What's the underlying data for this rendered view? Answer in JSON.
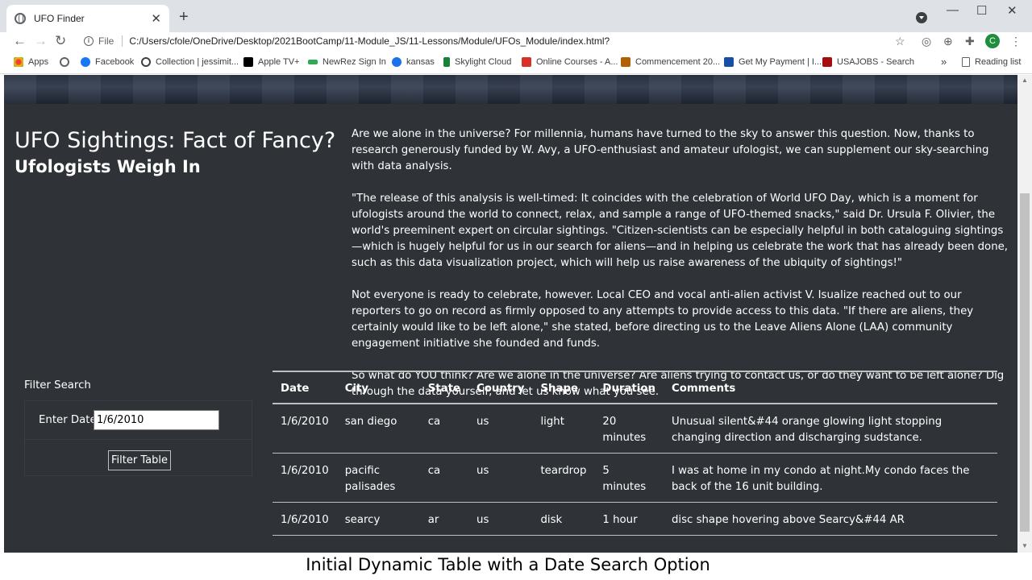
{
  "browser": {
    "tab_title": "UFO Finder",
    "tab_close": "✕",
    "new_tab": "+",
    "window_controls": [
      "—",
      "☐",
      "✕"
    ],
    "file_label": "File",
    "url": "C:/Users/cfole/OneDrive/Desktop/2021BootCamp/11-Module_JS/11-Lessons/Module/UFOs_Module/index.html?",
    "avatar_letter": "C"
  },
  "bookmarks": [
    {
      "label": "Apps",
      "icon": "apps-grid-icon",
      "color": "#ea4335"
    },
    {
      "label": "",
      "icon": "globe-icon",
      "color": "#5f6368"
    },
    {
      "label": "Facebook",
      "icon": "facebook-icon",
      "color": "#1877f2"
    },
    {
      "label": "Collection | jessimit...",
      "icon": "gear-icon",
      "color": "#3c4043"
    },
    {
      "label": "Apple TV+",
      "icon": "appletv-icon",
      "color": "#000000"
    },
    {
      "label": "NewRez Sign In",
      "icon": "newrez-icon",
      "color": "#34a853"
    },
    {
      "label": "kansas",
      "icon": "kansas-icon",
      "color": "#1a73e8"
    },
    {
      "label": "Skylight Cloud",
      "icon": "skylight-icon",
      "color": "#188038"
    },
    {
      "label": "Online Courses - A...",
      "icon": "courses-icon",
      "color": "#d93025"
    },
    {
      "label": "Commencement 20...",
      "icon": "commencement-icon",
      "color": "#b06000"
    },
    {
      "label": "Get My Payment | I...",
      "icon": "irs-icon",
      "color": "#174ea6"
    },
    {
      "label": "USAJOBS - Search",
      "icon": "usajobs-icon",
      "color": "#a50e0e"
    }
  ],
  "bookmarks_more": "»",
  "reading_list": "Reading list",
  "page": {
    "title": "UFO Sightings: Fact of Fancy?",
    "subtitle": "Ufologists Weigh In",
    "paragraphs": [
      "Are we alone in the universe? For millennia, humans have turned to the sky to answer this question. Now, thanks to research generously funded by W. Avy, a UFO-enthusiast and amateur ufologist, we can supplement our sky-searching with data analysis.",
      "\"The release of this analysis is well-timed: It coincides with the celebration of World UFO Day, which is a moment for ufologists around the world to connect, relax, and sample a range of UFO-themed snacks,\" said Dr. Ursula F. Olivier, the world's preeminent expert on circular sightings. \"Citizen-scientists can be especially helpful in both cataloguing sightings—which is hugely helpful for us in our search for aliens—and in helping us celebrate the work that has already been done, such as this data visualization project, which will help us raise awareness of the ubiquity of sightings!\"",
      "Not everyone is ready to celebrate, however. Local CEO and vocal anti-alien activist V. Isualize reached out to our reporters to go on record as firmly opposed to any attempts to provide access to this data. \"If there are aliens, they certainly would like to be left alone,\" she stated, before directing us to the Leave Aliens Alone (LAA) community engagement initiative she founded and funds.",
      "So what do YOU think? Are we alone in the universe? Are aliens trying to contact us, or do they want to be left alone? Dig through the data yourself, and let us know what you see."
    ],
    "filter": {
      "title": "Filter Search",
      "date_label": "Enter Date:",
      "date_value": "1/6/2010",
      "button": "Filter Table"
    },
    "table": {
      "headers": [
        "Date",
        "City",
        "State",
        "Country",
        "Shape",
        "Duration",
        "Comments"
      ],
      "rows": [
        [
          "1/6/2010",
          "san diego",
          "ca",
          "us",
          "light",
          "20 minutes",
          "Unusual silent&#44 orange glowing light stopping changing direction and discharging sudstance."
        ],
        [
          "1/6/2010",
          "pacific palisades",
          "ca",
          "us",
          "teardrop",
          "5 minutes",
          "I was at home in my condo at night.My condo faces the back of the 16 unit building."
        ],
        [
          "1/6/2010",
          "searcy",
          "ar",
          "us",
          "disk",
          "1 hour",
          "disc shape hovering above Searcy&#44 AR"
        ]
      ]
    }
  },
  "caption": "Initial Dynamic Table with a Date Search Option"
}
